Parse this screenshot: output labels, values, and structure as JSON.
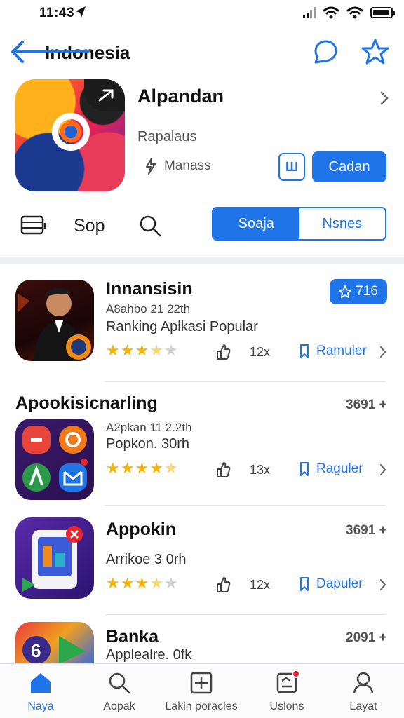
{
  "status_bar": {
    "time": "11:43"
  },
  "nav": {
    "title": "Indonesia"
  },
  "app": {
    "name": "Alpandan",
    "subtitle": "Rapalaus",
    "developer": "Manass",
    "square_button": "Ш",
    "get_button": "Cadan"
  },
  "tabs": {
    "label": "Sop",
    "segments": [
      "Soaja",
      "Nsnes"
    ]
  },
  "list": [
    {
      "title": "Innansisin",
      "meta": "A8ahbo 21 22th",
      "description": "Ranking Aplkasi Popular",
      "rating": 3.5,
      "likes": "12x",
      "link": "Ramuler",
      "badge": "716"
    },
    {
      "title": "",
      "meta": "A2pkan 11 2.2th",
      "description": "Popkon. 30rh",
      "rating": 4.5,
      "likes": "13x",
      "link": "Raguler"
    },
    {
      "title": "Appokin",
      "meta": "",
      "description": "Arrikoe 3 0rh",
      "rating": 3.5,
      "likes": "12x",
      "link": "Dapuler",
      "count": "3691 +"
    },
    {
      "title": "Banka",
      "meta": "",
      "description": "Applealre. 0fk",
      "count": "2091 +"
    }
  ],
  "section": {
    "heading": "Apookisicnarling",
    "count": "3691 +"
  },
  "tabbar": [
    {
      "label": "Naya",
      "icon": "home-icon",
      "active": true
    },
    {
      "label": "Aopak",
      "icon": "search-icon",
      "active": false
    },
    {
      "label": "Lakin poracles",
      "icon": "grid-plus-icon",
      "active": false
    },
    {
      "label": "Uslons",
      "icon": "updates-icon",
      "active": false
    },
    {
      "label": "Layat",
      "icon": "person-icon",
      "active": false
    }
  ],
  "colors": {
    "accent": "#1f74e8",
    "star": "#f5b400",
    "badge_red": "#e6262f"
  }
}
